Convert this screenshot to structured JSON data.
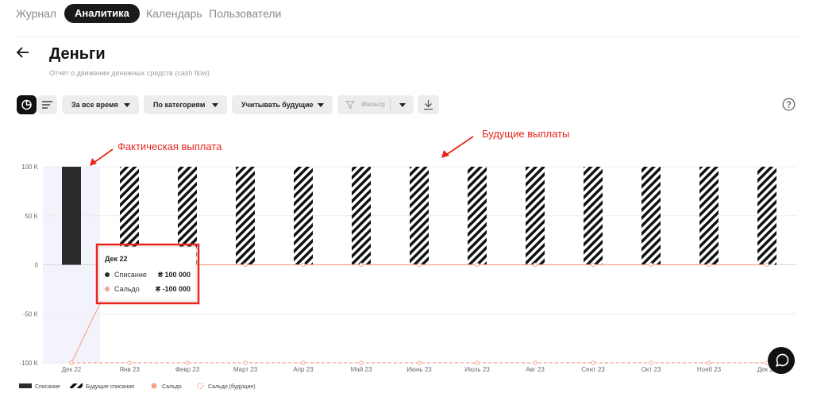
{
  "nav": {
    "items": [
      {
        "label": "Журнал",
        "active": false
      },
      {
        "label": "Аналитика",
        "active": true
      },
      {
        "label": "Календарь",
        "active": false
      },
      {
        "label": "Пользователи",
        "active": false
      }
    ]
  },
  "page": {
    "title": "Деньги",
    "subtitle": "Отчет о движении денежных средств (cash flow)"
  },
  "toolbar": {
    "period_label": "За все время",
    "group_label": "По категориям",
    "future_label": "Учитывать будущие",
    "filter_placeholder": "Фильтр",
    "view_icon": "pie-chart-icon",
    "list_icon": "list-lines-icon",
    "download_icon": "download-icon",
    "help_icon": "help-circle-icon"
  },
  "annotations": {
    "actual": "Фактическая выплата",
    "future": "Будущие выплаты",
    "color": "#e8241b"
  },
  "tooltip": {
    "date": "Дек 22",
    "rows": [
      {
        "label": "Списание",
        "value": "₴ 100 000"
      },
      {
        "label": "Сальдо",
        "value": "₴ -100 000"
      }
    ]
  },
  "chart_data": {
    "type": "bar",
    "categories": [
      "Дек 22",
      "Янв 23",
      "Февр 23",
      "Март 23",
      "Апр 23",
      "Май 23",
      "Июнь 23",
      "Июль 23",
      "Авг 23",
      "Сент 23",
      "Окт 23",
      "Нояб 23",
      "Дек 23"
    ],
    "ylim": [
      -100000,
      100000
    ],
    "yticks": [
      100000,
      50000,
      0,
      -50000,
      -100000
    ],
    "ytick_labels": [
      "100 K",
      "50 K",
      "0",
      "-50 K",
      "-100 K"
    ],
    "grid": true,
    "legend_position": "bottom-left",
    "series": [
      {
        "name": "Списание",
        "values": [
          100000,
          null,
          null,
          null,
          null,
          null,
          null,
          null,
          null,
          null,
          null,
          null,
          null
        ],
        "color": "#2b2b2b"
      },
      {
        "name": "Будущие списания",
        "values": [
          null,
          100000,
          100000,
          100000,
          100000,
          100000,
          100000,
          100000,
          100000,
          100000,
          100000,
          100000,
          100000
        ],
        "pattern": "hatched"
      },
      {
        "name": "Сальдо",
        "values": [
          -100000,
          0,
          0,
          0,
          0,
          0,
          0,
          0,
          0,
          0,
          0,
          0,
          0
        ],
        "color": "#f4a48f"
      },
      {
        "name": "Сальдо (будущие)",
        "values": [
          -100000,
          -100000,
          -100000,
          -100000,
          -100000,
          -100000,
          -100000,
          -100000,
          -100000,
          -100000,
          -100000,
          -100000,
          -100000
        ],
        "color": "#f4a48f",
        "style": "dashed"
      }
    ]
  }
}
